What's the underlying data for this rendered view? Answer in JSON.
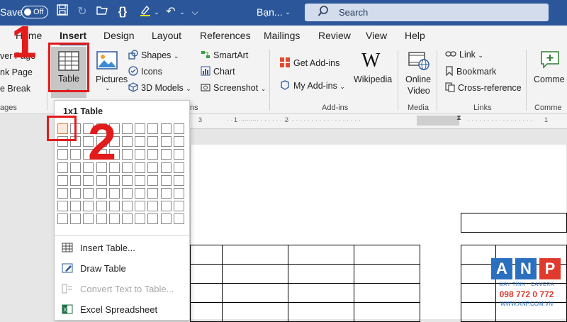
{
  "titlebar": {
    "autosave_label": "Save",
    "toggle_state": "Off",
    "doc_name": "Bạn...",
    "search_placeholder": "Search"
  },
  "tabs": [
    {
      "label": "Home"
    },
    {
      "label": "Insert"
    },
    {
      "label": "Design"
    },
    {
      "label": "Layout"
    },
    {
      "label": "References"
    },
    {
      "label": "Mailings"
    },
    {
      "label": "Review"
    },
    {
      "label": "View"
    },
    {
      "label": "Help"
    }
  ],
  "ribbon": {
    "pages": {
      "items": [
        "ver Page",
        "nk Page",
        "e Break"
      ],
      "group_label": "ages"
    },
    "table_button": "Table",
    "illustrations": {
      "pictures": "Pictures",
      "shapes": "Shapes",
      "icons": "Icons",
      "models_3d": "3D Models",
      "smartart": "SmartArt",
      "chart": "Chart",
      "screenshot": "Screenshot",
      "group_label": "ns"
    },
    "addins": {
      "get_addins": "Get Add-ins",
      "my_addins": "My Add-ins",
      "wikipedia": "Wikipedia",
      "group_label": "Add-ins"
    },
    "media": {
      "online_video_1": "Online",
      "online_video_2": "Video",
      "group_label": "Media"
    },
    "links": {
      "link": "Link",
      "bookmark": "Bookmark",
      "cross_reference": "Cross-reference",
      "group_label": "Links"
    },
    "comments": {
      "comment": "Comme",
      "group_label": "Comme"
    }
  },
  "ruler": {
    "marks": [
      "3",
      "1",
      "2",
      "1"
    ]
  },
  "table_dropdown": {
    "title": "1x1 Table",
    "grid_cols": 10,
    "grid_rows": 8,
    "selected": [
      1,
      1
    ],
    "items": [
      {
        "label": "Insert Table...",
        "enabled": true,
        "icon": "insert-table-icon"
      },
      {
        "label": "Draw Table",
        "enabled": true,
        "icon": "draw-table-icon"
      },
      {
        "label": "Convert Text to Table...",
        "enabled": false,
        "icon": "convert-text-icon"
      },
      {
        "label": "Excel Spreadsheet",
        "enabled": true,
        "icon": "excel-icon"
      }
    ]
  },
  "annotations": {
    "step1": "1",
    "step2": "2"
  },
  "logo": {
    "letters": [
      "A",
      "N",
      "P"
    ],
    "line1": "MÁY TÍNH - CAMERA",
    "line2": "098 772 0 772",
    "line3": "WWW.ANP.COM.VN"
  },
  "colors": {
    "word_blue": "#2b579a",
    "annotation_red": "#e21b1b",
    "cell_highlight": "#e07a3c",
    "logo_blue": "#2b6fbf",
    "logo_red": "#e03a2d"
  }
}
